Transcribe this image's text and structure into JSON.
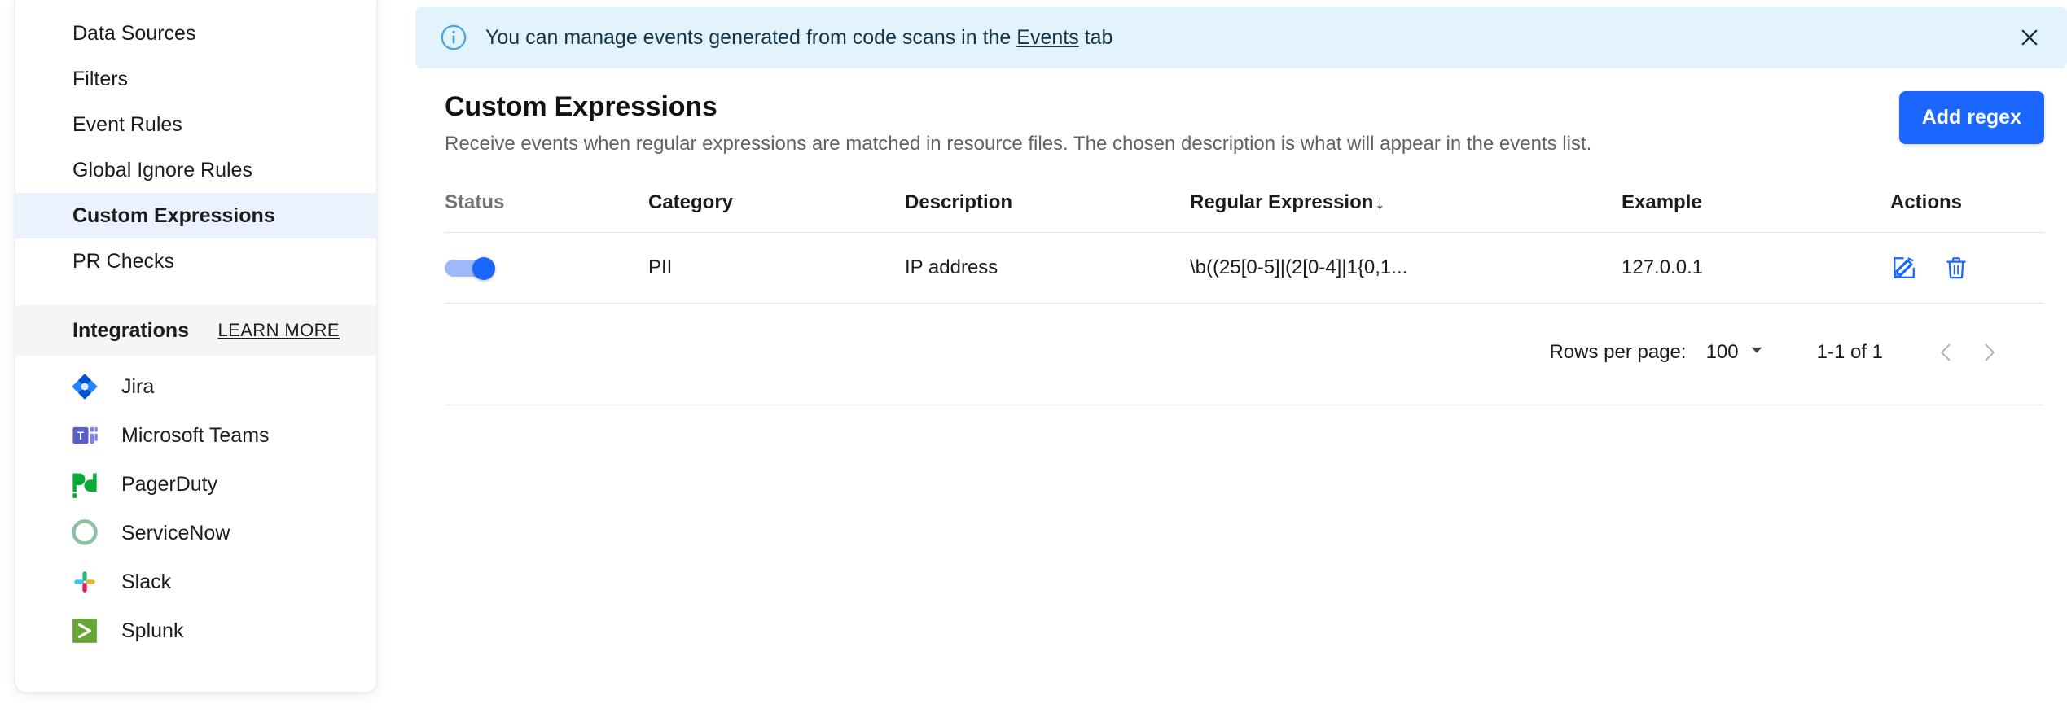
{
  "sidebar": {
    "nav_items": [
      {
        "label": "Data Sources",
        "active": false
      },
      {
        "label": "Filters",
        "active": false
      },
      {
        "label": "Event Rules",
        "active": false
      },
      {
        "label": "Global Ignore Rules",
        "active": false
      },
      {
        "label": "Custom Expressions",
        "active": true
      },
      {
        "label": "PR Checks",
        "active": false
      }
    ],
    "integrations": {
      "title": "Integrations",
      "learn_more": "LEARN MORE",
      "items": [
        {
          "label": "Jira",
          "icon": "jira-icon"
        },
        {
          "label": "Microsoft Teams",
          "icon": "microsoft-teams-icon"
        },
        {
          "label": "PagerDuty",
          "icon": "pagerduty-icon"
        },
        {
          "label": "ServiceNow",
          "icon": "servicenow-icon"
        },
        {
          "label": "Slack",
          "icon": "slack-icon"
        },
        {
          "label": "Splunk",
          "icon": "splunk-icon"
        }
      ]
    }
  },
  "banner": {
    "icon": "info-circle-icon",
    "text_before_link": "You can manage events generated from code scans in the ",
    "link_text": "Events",
    "text_after_link": " tab",
    "close_icon": "close-icon"
  },
  "header": {
    "title": "Custom Expressions",
    "subtitle": "Receive events when regular expressions are matched in resource files. The chosen description is what will appear in the events list.",
    "add_button_label": "Add regex"
  },
  "table": {
    "columns": [
      {
        "label": "Status",
        "key": "status"
      },
      {
        "label": "Category",
        "key": "category"
      },
      {
        "label": "Description",
        "key": "description"
      },
      {
        "label": "Regular Expression",
        "key": "regex",
        "sorted": true,
        "sort_arrow": "↓"
      },
      {
        "label": "Example",
        "key": "example"
      },
      {
        "label": "Actions",
        "key": "actions"
      }
    ],
    "rows": [
      {
        "status_enabled": true,
        "category": "PII",
        "description": "IP address",
        "regex": "\\b((25[0-5]|(2[0-4]|1{0,1...",
        "example": "127.0.0.1",
        "actions": [
          {
            "name": "edit-icon",
            "label": "Edit"
          },
          {
            "name": "delete-icon",
            "label": "Delete"
          }
        ]
      }
    ]
  },
  "pagination": {
    "rows_per_page_label": "Rows per page:",
    "rows_per_page_value": "100",
    "range_label": "1-1 of 1",
    "prev_icon": "chevron-left-icon",
    "next_icon": "chevron-right-icon"
  },
  "colors": {
    "accent_blue": "#1a66ff",
    "banner_bg": "#e3f3fb",
    "active_nav_bg": "#eaf2fd",
    "toggle_track": "#9db9fb",
    "border": "#e3e3e3"
  }
}
